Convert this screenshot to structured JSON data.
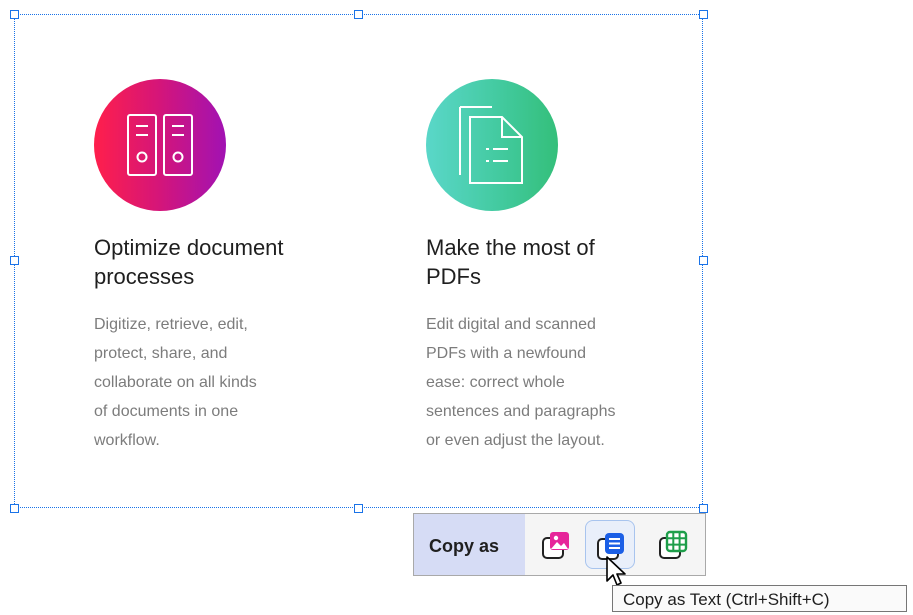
{
  "cards": [
    {
      "icon": "document-binders-icon",
      "accent": "#e2196a",
      "title": "Optimize document\nprocesses",
      "body": "Digitize, retrieve, edit,\nprotect, share, and\ncollaborate on all kinds\nof documents in one\nworkflow."
    },
    {
      "icon": "pdf-document-icon",
      "accent": "#3ec98f",
      "title": "Make the most of\nPDFs",
      "body": "Edit digital and scanned\nPDFs with a newfound\nease: correct whole\nsentences and paragraphs\nor even adjust the layout."
    }
  ],
  "copy_toolbar": {
    "label": "Copy as",
    "buttons": [
      {
        "icon": "copy-as-image-icon",
        "active": false
      },
      {
        "icon": "copy-as-text-icon",
        "active": true
      },
      {
        "icon": "copy-as-table-icon",
        "active": false
      }
    ]
  },
  "tooltip": {
    "text": "Copy as Text (Ctrl+Shift+C)"
  }
}
